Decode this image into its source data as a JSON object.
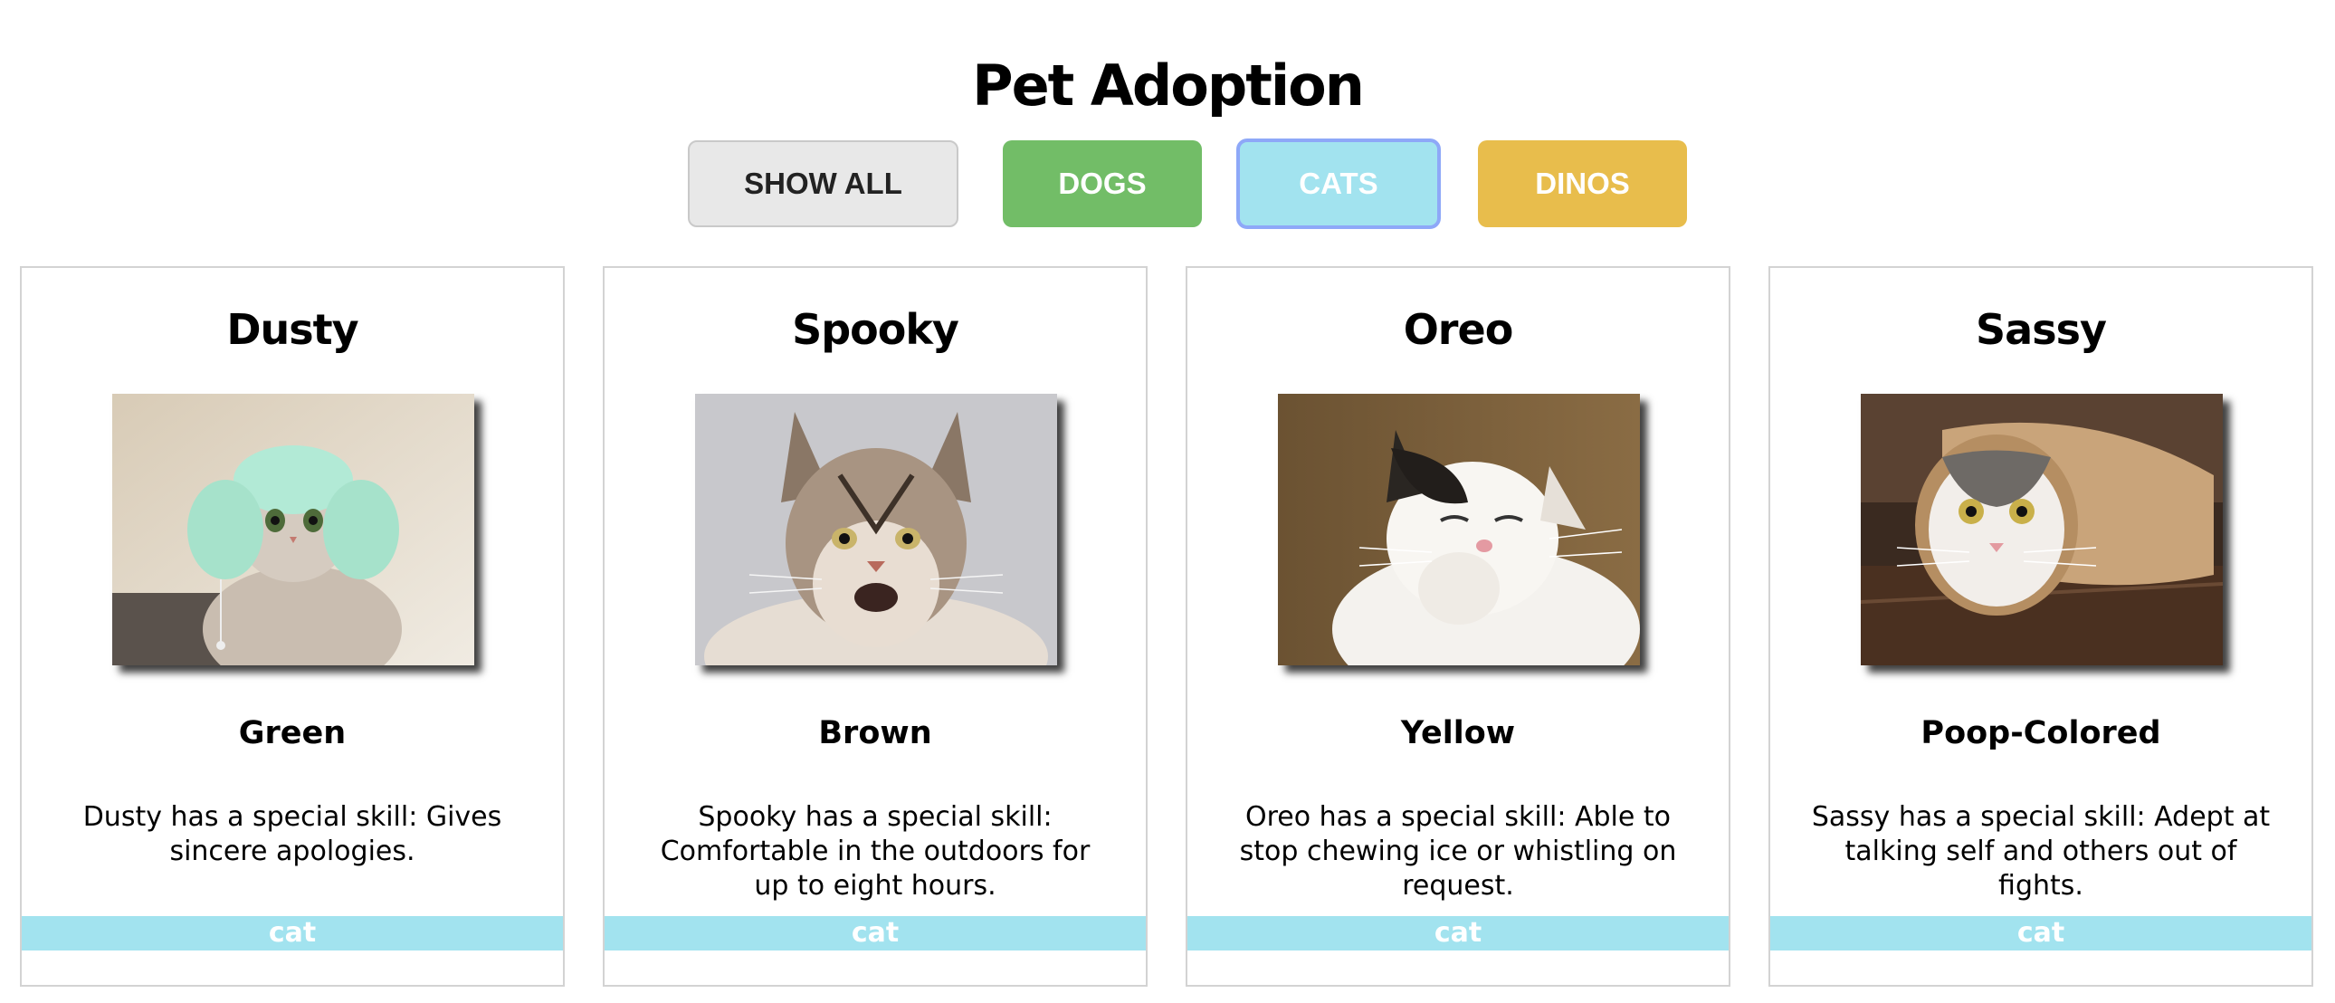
{
  "page": {
    "title": "Pet Adoption"
  },
  "filters": {
    "show_all": "SHOW ALL",
    "dogs": "DOGS",
    "cats": "CATS",
    "dinos": "DINOS",
    "active": "CATS"
  },
  "colors": {
    "dogs": "#72bd67",
    "cats": "#a2e3ef",
    "dinos": "#e8bd4c",
    "show_all": "#e8e8e8"
  },
  "pets": [
    {
      "name": "Dusty",
      "color": "Green",
      "description": "Dusty has a special skill: Gives sincere apologies.",
      "type": "cat",
      "photo": "cat-in-knitted-hat-photo"
    },
    {
      "name": "Spooky",
      "color": "Brown",
      "description": "Spooky has a special skill: Comfortable in the outdoors for up to eight hours.",
      "type": "cat",
      "photo": "maine-coon-cat-photo"
    },
    {
      "name": "Oreo",
      "color": "Yellow",
      "description": "Oreo has a special skill: Able to stop chewing ice or whistling on request.",
      "type": "cat",
      "photo": "laughing-black-white-cat-photo"
    },
    {
      "name": "Sassy",
      "color": "Poop-Colored",
      "description": "Sassy has a special skill: Adept at talking self and others out of fights.",
      "type": "cat",
      "photo": "cat-in-paper-roll-photo"
    }
  ]
}
